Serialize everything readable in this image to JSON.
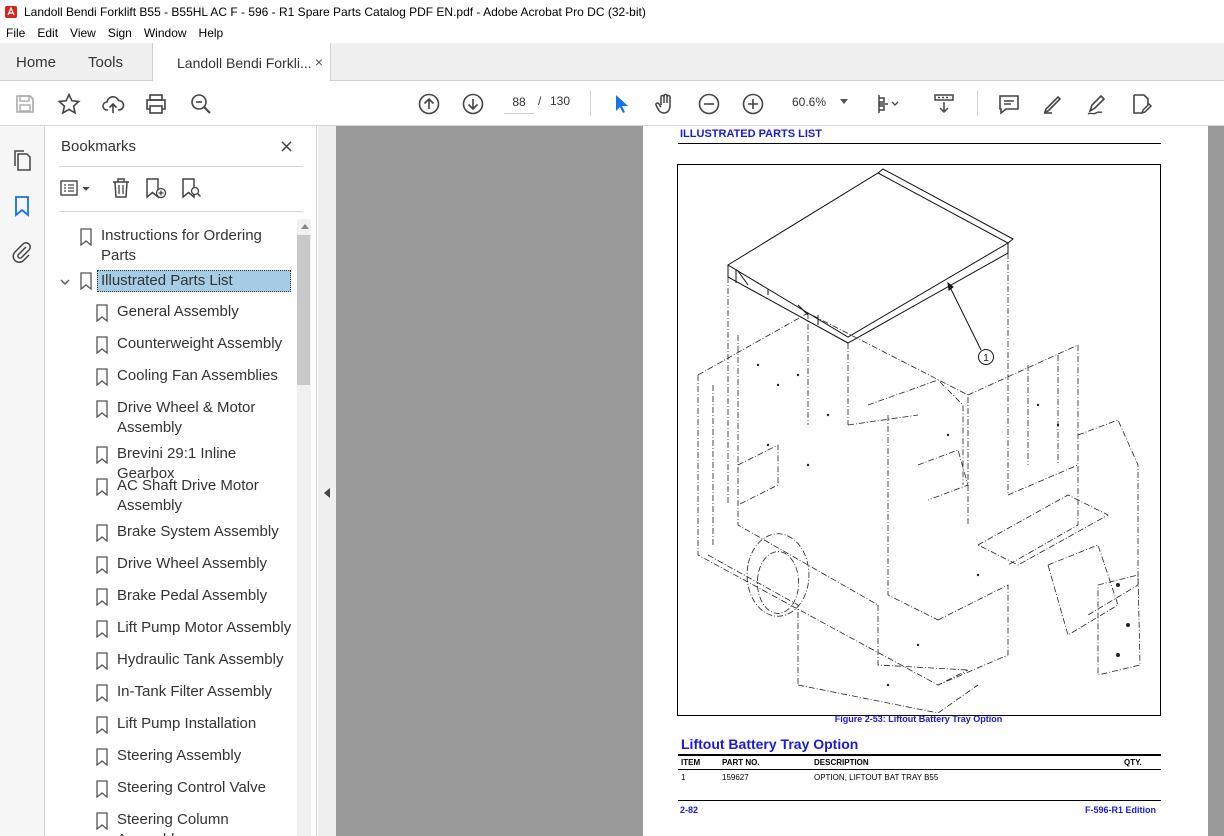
{
  "window": {
    "title": "Landoll Bendi Forklift B55 - B55HL AC  F - 596 - R1 Spare Parts Catalog PDF EN.pdf - Adobe Acrobat Pro DC (32-bit)"
  },
  "menu": [
    "File",
    "Edit",
    "View",
    "Sign",
    "Window",
    "Help"
  ],
  "tabs": {
    "home": "Home",
    "tools": "Tools",
    "document": "Landoll Bendi Forkli...",
    "close": "×"
  },
  "toolbar": {
    "page_current": "88",
    "page_sep": "/",
    "page_total": "130",
    "zoom": "60.6%",
    "icons": [
      "save-icon",
      "star-icon",
      "upload-cloud-icon",
      "print-icon",
      "search-zoom-icon",
      "page-up-icon",
      "page-down-icon",
      "select-pointer-icon",
      "hand-icon",
      "zoom-out-icon",
      "zoom-in-icon",
      "fit-page-icon",
      "scroll-mode-icon",
      "comment-icon",
      "highlight-pen-icon",
      "sign-icon",
      "edit-pdf-icon"
    ]
  },
  "bookmarks_panel": {
    "title": "Bookmarks",
    "close": "×",
    "items": [
      {
        "label": "Instructions for Ordering Parts",
        "lines": [
          "Instructions for Ordering",
          "Parts"
        ],
        "level": 0
      },
      {
        "label": "Illustrated Parts List",
        "lines": [
          "Illustrated Parts List"
        ],
        "level": 0,
        "selected": true,
        "expanded": true
      },
      {
        "label": "General Assembly",
        "lines": [
          "General Assembly"
        ],
        "level": 1
      },
      {
        "label": "Counterweight Assembly",
        "lines": [
          "Counterweight Assembly"
        ],
        "level": 1
      },
      {
        "label": "Cooling Fan Assemblies",
        "lines": [
          "Cooling Fan Assemblies"
        ],
        "level": 1
      },
      {
        "label": "Drive Wheel & Motor Assembly",
        "lines": [
          "Drive Wheel & Motor",
          "Assembly"
        ],
        "level": 1
      },
      {
        "label": "Brevini 29:1 Inline Gearbox",
        "lines": [
          "Brevini 29:1 Inline Gearbox"
        ],
        "level": 1
      },
      {
        "label": "AC Shaft Drive Motor Assembly",
        "lines": [
          "AC Shaft Drive Motor",
          "Assembly"
        ],
        "level": 1
      },
      {
        "label": "Brake System Assembly",
        "lines": [
          "Brake System Assembly"
        ],
        "level": 1
      },
      {
        "label": "Drive Wheel Assembly",
        "lines": [
          "Drive Wheel Assembly"
        ],
        "level": 1
      },
      {
        "label": "Brake Pedal Assembly",
        "lines": [
          "Brake Pedal Assembly"
        ],
        "level": 1
      },
      {
        "label": "Lift Pump Motor Assembly",
        "lines": [
          "Lift Pump Motor Assembly"
        ],
        "level": 1
      },
      {
        "label": "Hydraulic Tank Assembly",
        "lines": [
          "Hydraulic Tank Assembly"
        ],
        "level": 1
      },
      {
        "label": "In-Tank Filter Assembly",
        "lines": [
          "In-Tank Filter Assembly"
        ],
        "level": 1
      },
      {
        "label": "Lift Pump Installation",
        "lines": [
          "Lift Pump Installation"
        ],
        "level": 1
      },
      {
        "label": "Steering Assembly",
        "lines": [
          "Steering Assembly"
        ],
        "level": 1
      },
      {
        "label": "Steering Control Valve",
        "lines": [
          "Steering Control Valve"
        ],
        "level": 1
      },
      {
        "label": "Steering Column Assembly",
        "lines": [
          "Steering Column",
          "Assembly"
        ],
        "level": 1
      }
    ]
  },
  "pdf_page": {
    "header": "ILLUSTRATED PARTS LIST",
    "callout": "1",
    "figure_caption": "Figure 2-53:  Liftout Battery Tray Option",
    "section_title": "Liftout Battery Tray Option",
    "table": {
      "headers": [
        "ITEM",
        "PART NO.",
        "DESCRIPTION",
        "QTY."
      ],
      "rows": [
        [
          "1",
          "159627",
          "OPTION, LIFTOUT BAT TRAY B55",
          ""
        ]
      ]
    },
    "footer_left": "2-82",
    "footer_right": "F-596-R1 Edition"
  },
  "colors": {
    "link_blue": "#1a1ad6",
    "selection": "#a6cde6",
    "canvas_gray": "#9a9a9a",
    "acrobat_red": "#d4261c"
  }
}
